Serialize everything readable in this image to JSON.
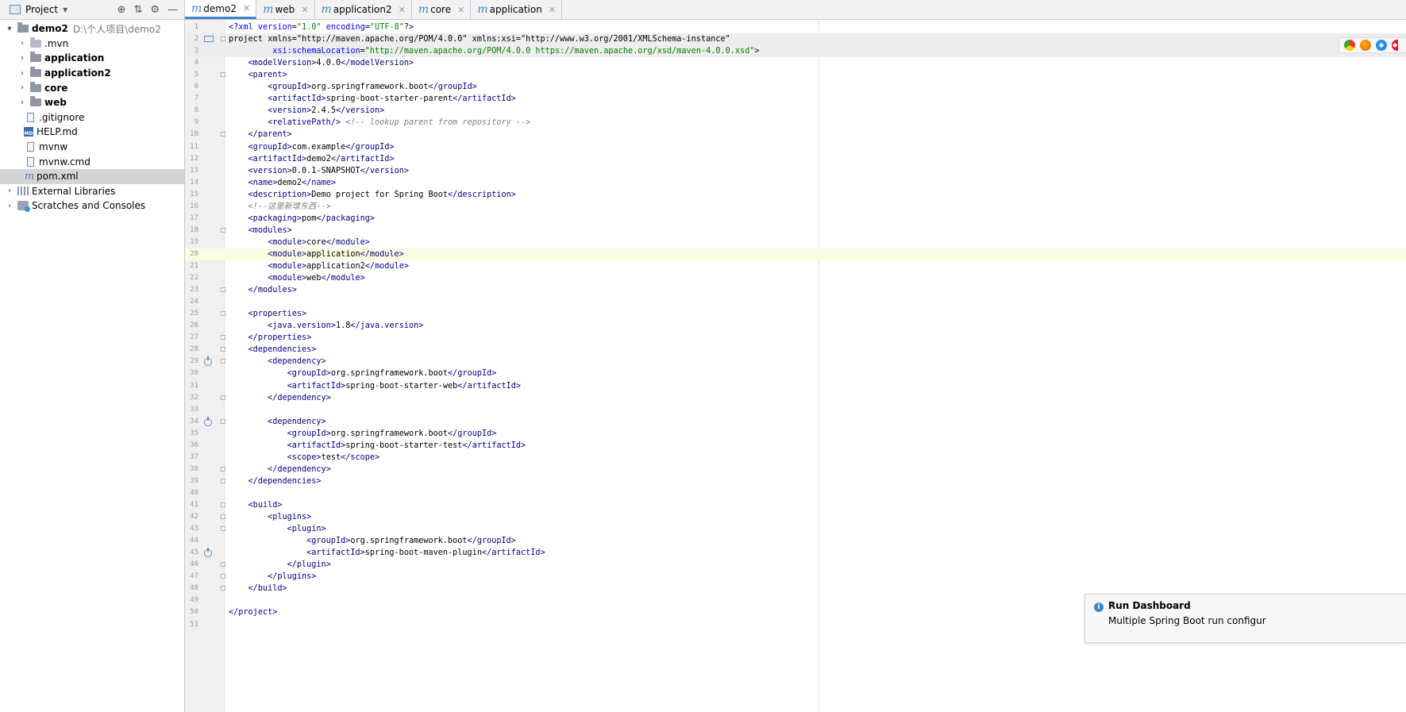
{
  "project_panel": {
    "title": "Project",
    "tree": [
      {
        "label": "demo2",
        "path": "D:\\个人项目\\demo2",
        "icon": "module-folder-icon"
      },
      {
        "label": ".mvn",
        "icon": "folder-icon"
      },
      {
        "label": "application",
        "icon": "module-folder-icon"
      },
      {
        "label": "application2",
        "icon": "module-folder-icon"
      },
      {
        "label": "core",
        "icon": "module-folder-icon"
      },
      {
        "label": "web",
        "icon": "module-folder-icon"
      },
      {
        "label": ".gitignore",
        "icon": "text-file-icon"
      },
      {
        "label": "HELP.md",
        "icon": "markdown-file-icon"
      },
      {
        "label": "mvnw",
        "icon": "text-file-icon"
      },
      {
        "label": "mvnw.cmd",
        "icon": "text-file-icon"
      },
      {
        "label": "pom.xml",
        "icon": "maven-file-icon"
      },
      {
        "label": "External Libraries",
        "icon": "library-icon"
      },
      {
        "label": "Scratches and Consoles",
        "icon": "scratches-icon"
      }
    ]
  },
  "tabs": [
    {
      "label": "demo2",
      "active": true
    },
    {
      "label": "web"
    },
    {
      "label": "application2"
    },
    {
      "label": "core"
    },
    {
      "label": "application"
    }
  ],
  "editor": {
    "lines": [
      "<?xml version=\"1.0\" encoding=\"UTF-8\"?>",
      "<project xmlns=\"http://maven.apache.org/POM/4.0.0\" xmlns:xsi=\"http://www.w3.org/2001/XMLSchema-instance\"",
      "         xsi:schemaLocation=\"http://maven.apache.org/POM/4.0.0 https://maven.apache.org/xsd/maven-4.0.0.xsd\">",
      "    <modelVersion>4.0.0</modelVersion>",
      "    <parent>",
      "        <groupId>org.springframework.boot</groupId>",
      "        <artifactId>spring-boot-starter-parent</artifactId>",
      "        <version>2.4.5</version>",
      "        <relativePath/> <!-- lookup parent from repository -->",
      "    </parent>",
      "    <groupId>com.example</groupId>",
      "    <artifactId>demo2</artifactId>",
      "    <version>0.0.1-SNAPSHOT</version>",
      "    <name>demo2</name>",
      "    <description>Demo project for Spring Boot</description>",
      "    <!--这里新增东西-->",
      "    <packaging>pom</packaging>",
      "    <modules>",
      "        <module>core</module>",
      "        <module>application</module>",
      "        <module>application2</module>",
      "        <module>web</module>",
      "    </modules>",
      "",
      "    <properties>",
      "        <java.version>1.8</java.version>",
      "    </properties>",
      "    <dependencies>",
      "        <dependency>",
      "            <groupId>org.springframework.boot</groupId>",
      "            <artifactId>spring-boot-starter-web</artifactId>",
      "        </dependency>",
      "",
      "        <dependency>",
      "            <groupId>org.springframework.boot</groupId>",
      "            <artifactId>spring-boot-starter-test</artifactId>",
      "            <scope>test</scope>",
      "        </dependency>",
      "    </dependencies>",
      "",
      "    <build>",
      "        <plugins>",
      "            <plugin>",
      "                <groupId>org.springframework.boot</groupId>",
      "                <artifactId>spring-boot-maven-plugin</artifactId>",
      "            </plugin>",
      "        </plugins>",
      "    </build>",
      "",
      "</project>",
      ""
    ],
    "current_line": 20,
    "fold_lines": [
      2,
      5,
      10,
      18,
      23,
      25,
      27,
      28,
      29,
      32,
      34,
      38,
      39,
      41,
      42,
      43,
      46,
      47,
      48
    ],
    "gutter_icon_lines": [
      29,
      34,
      45
    ]
  },
  "browser_icons": [
    "chrome-icon",
    "firefox-icon",
    "safari-icon",
    "opera-icon"
  ],
  "notification": {
    "title": "Run Dashboard",
    "body": "Multiple Spring Boot run configur"
  }
}
